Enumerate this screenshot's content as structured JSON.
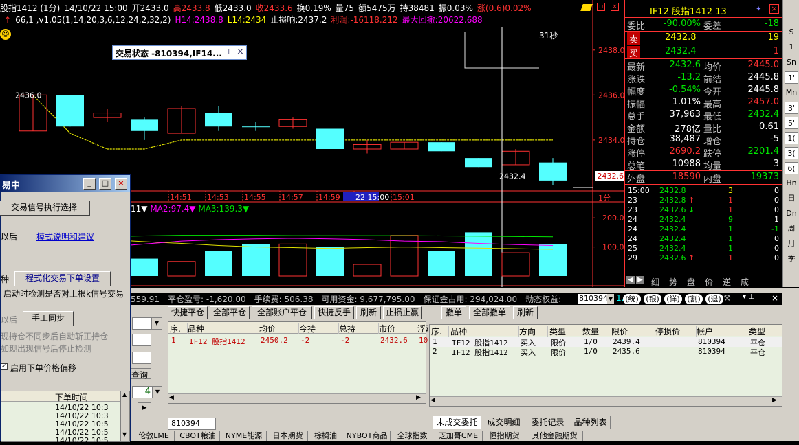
{
  "quote_bar": {
    "symbol": "股指1412 (1分)",
    "datetime": "14/10/22 15:00",
    "open": "开2433.0",
    "high": "高2433.8",
    "low": "低2433.0",
    "close": "收2433.6",
    "turnover_rate": "换0.19%",
    "volume": "量75",
    "amount": "额5475万",
    "position": "持38481",
    "amplitude": "振0.03%",
    "change": "涨(0.6)0.02%"
  },
  "indicator_bar": {
    "params": "66,1 ,v1.05(1,14,20,3,6,12,24,2,32,2)",
    "h14": "H14:2438.8",
    "l14": "L14:2434",
    "stop_loss": "止损响:2437.2",
    "profit": "利润:-16118.212",
    "max_drawdown": "最大回撤:20622.688"
  },
  "chart_data": {
    "type": "candlestick",
    "x_ticks": [
      "14:51",
      "14:53",
      "14:55",
      "14:57",
      "14:59",
      "22 15:00",
      "15:01"
    ],
    "y_ticks": [
      "2438.0",
      "2436.0",
      "2434.0"
    ],
    "current_price_label": "2432.6",
    "countdown": "31秒",
    "candles": [
      {
        "open": 2436.0,
        "close": 2434.4,
        "high": 2436.0,
        "low": 2434.4,
        "up": true
      },
      {
        "open": 2434.6,
        "close": 2436.0,
        "high": 2436.0,
        "low": 2434.6,
        "up": false
      },
      {
        "open": 2435.2,
        "close": 2435.0,
        "high": 2435.4,
        "low": 2434.8,
        "up": true
      },
      {
        "open": 2434.9,
        "close": 2434.4,
        "high": 2435.0,
        "low": 2434.0,
        "up": false
      },
      {
        "open": 2434.3,
        "close": 2435.4,
        "high": 2435.5,
        "low": 2434.3,
        "up": true
      },
      {
        "open": 2435.2,
        "close": 2434.6,
        "high": 2435.5,
        "low": 2434.4,
        "up": false
      },
      {
        "open": 2434.6,
        "close": 2434.6,
        "high": 2434.8,
        "low": 2434.4,
        "up": false
      },
      {
        "open": 2434.6,
        "close": 2434.9,
        "high": 2435.0,
        "low": 2434.5,
        "up": true
      },
      {
        "open": 2434.5,
        "close": 2433.6,
        "high": 2434.5,
        "low": 2433.6,
        "up": false
      },
      {
        "open": 2433.8,
        "close": 2433.6,
        "high": 2434.0,
        "low": 2433.4,
        "up": true
      },
      {
        "open": 2433.6,
        "close": 2433.9,
        "high": 2433.9,
        "low": 2433.6,
        "up": true
      },
      {
        "open": 2433.9,
        "close": 2433.5,
        "high": 2433.9,
        "low": 2433.5,
        "up": false
      },
      {
        "open": 2433.2,
        "close": 2432.8,
        "high": 2433.2,
        "low": 2432.8,
        "up": false
      },
      {
        "open": 2432.9,
        "close": 2433.5,
        "high": 2433.6,
        "low": 2432.9,
        "up": true
      },
      {
        "open": 2433.0,
        "close": 2432.2,
        "high": 2433.2,
        "low": 2432.0,
        "up": false
      }
    ],
    "annotations": [
      "2436.0",
      "2432.4"
    ],
    "ymin": 2431.8,
    "ymax": 2439.0,
    "volume_ticks": [
      "200.0",
      "100.0"
    ],
    "volume_legend": [
      "11▼",
      "MA2:97.4▼",
      "MA3:139.3▼"
    ],
    "volumes": [
      120,
      115,
      40,
      60,
      50,
      85,
      110,
      110,
      100,
      40,
      140,
      85,
      150,
      80,
      110
    ],
    "volume_max": 250,
    "ma_trace": [
      150,
      140,
      125,
      118,
      112,
      105,
      100,
      98,
      95,
      98,
      100,
      98,
      96,
      94,
      92
    ],
    "ma2_trace": [
      70,
      80,
      100,
      110,
      120,
      125,
      128,
      130,
      128,
      125,
      120,
      118,
      112,
      108,
      105
    ],
    "ma3_trace": [
      130,
      132,
      135,
      138,
      140,
      140,
      140,
      139,
      139,
      139,
      139,
      138,
      137,
      136,
      135
    ],
    "stop_line": [
      2436.0,
      2434.3,
      2433.6,
      2433.6,
      2434.0,
      2434.0,
      2434.0,
      2434.0,
      2434.0,
      2434.0,
      2434.0,
      2434.0,
      2434.0,
      2434.0,
      2434.0
    ],
    "hi_line": [
      2438.8,
      2438.8,
      2438.8,
      2438.8,
      2438.8,
      2438.8,
      2438.8,
      2438.8,
      2438.8,
      2438.8,
      2438.8,
      2438.8,
      2437.2,
      2437.2,
      2437.2
    ]
  },
  "right_panel": {
    "title": "IF12  股指1412  13",
    "weibi_label": "委比",
    "weibi": "-90.00%",
    "weicha_label": "委差",
    "weicha": "-18",
    "sell_label": "卖",
    "sell_price": "2432.8",
    "sell_qty": "19",
    "buy_label": "买",
    "buy_price": "2432.4",
    "buy_qty": "1",
    "rows": [
      {
        "k1": "最新",
        "v1": "2432.6",
        "c1": "g",
        "k2": "均价",
        "v2": "2445.0",
        "c2": "r"
      },
      {
        "k1": "涨跌",
        "v1": "-13.2",
        "c1": "g",
        "k2": "前结",
        "v2": "2445.8",
        "c2": "w"
      },
      {
        "k1": "幅度",
        "v1": "-0.54%",
        "c1": "g",
        "k2": "今开",
        "v2": "2445.8",
        "c2": "w"
      },
      {
        "k1": "振幅",
        "v1": "1.01%",
        "c1": "w",
        "k2": "最高",
        "v2": "2457.0",
        "c2": "r"
      },
      {
        "k1": "总手",
        "v1": "37,963",
        "c1": "w",
        "k2": "最低",
        "v2": "2432.4",
        "c2": "g"
      },
      {
        "k1": "金额",
        "v1": "278亿",
        "c1": "w",
        "k2": "量比",
        "v2": "0.61",
        "c2": "w"
      },
      {
        "k1": "持仓",
        "v1": "38,487",
        "c1": "w",
        "k2": "增仓",
        "v2": "-5",
        "c2": "w"
      },
      {
        "k1": "涨停",
        "v1": "2690.2",
        "c1": "r",
        "k2": "跌停",
        "v2": "2201.4",
        "c2": "g"
      },
      {
        "k1": "总笔",
        "v1": "10988",
        "c1": "w",
        "k2": "均量",
        "v2": "3",
        "c2": "w"
      }
    ],
    "outer_label": "外盘",
    "outer": "18590",
    "inner_label": "内盘",
    "inner": "19373",
    "ticks": [
      {
        "t": "15:00",
        "p": "2432.8",
        "a": "",
        "v": "3",
        "d": "0",
        "pc": "g",
        "ac": "w",
        "vc": "y",
        "dc": "w"
      },
      {
        "t": "23",
        "p": "2432.8",
        "a": "↑",
        "v": "1",
        "d": "0",
        "pc": "g",
        "ac": "r",
        "vc": "r",
        "dc": "w"
      },
      {
        "t": "23",
        "p": "2432.6",
        "a": "↓",
        "v": "1",
        "d": "0",
        "pc": "g",
        "ac": "g",
        "vc": "r",
        "dc": "w"
      },
      {
        "t": "24",
        "p": "2432.4",
        "a": "",
        "v": "9",
        "d": "1",
        "pc": "g",
        "ac": "w",
        "vc": "g",
        "dc": "w"
      },
      {
        "t": "24",
        "p": "2432.4",
        "a": "",
        "v": "1",
        "d": "-1",
        "pc": "g",
        "ac": "w",
        "vc": "g",
        "dc": "g"
      },
      {
        "t": "24",
        "p": "2432.4",
        "a": "",
        "v": "1",
        "d": "0",
        "pc": "g",
        "ac": "w",
        "vc": "g",
        "dc": "w"
      },
      {
        "t": "25",
        "p": "2432.4",
        "a": "",
        "v": "1",
        "d": "0",
        "pc": "g",
        "ac": "w",
        "vc": "g",
        "dc": "w"
      },
      {
        "t": "29",
        "p": "2432.6",
        "a": "↑",
        "v": "1",
        "d": "0",
        "pc": "g",
        "ac": "r",
        "vc": "r",
        "dc": "w"
      }
    ],
    "tabs": [
      "细",
      "势",
      "盘",
      "价",
      "逆",
      "成"
    ]
  },
  "far_right": [
    "S",
    "1",
    "Sn",
    "1'",
    "Mn",
    "3'",
    "5'",
    "1(",
    "3(",
    "6(",
    "Hn",
    "日",
    "Dn",
    "周",
    "月",
    "季"
  ],
  "float_window": {
    "title": "交易状态 -810394,IF14..."
  },
  "dialog": {
    "title": "易中",
    "exec_btn": "交易信号执行选择",
    "after_label": "以后",
    "mode_link": "模式说明和建议",
    "kind_label": "种",
    "settings_btn": "程式化交易下单设置",
    "check_note": "启动时检测是否对上根k信号交易",
    "after2_label": "以后",
    "manual_btn": "手工同步",
    "note1": "现持仓不同步后自动斩正持仓",
    "note2": "如现出现信号后停止检测",
    "price_offset": "启用下单价格偏移",
    "time_header": "下单时间",
    "times": [
      "14/10/22 10:3",
      "14/10/22 10:3",
      "14/10/22 10:5",
      "14/10/22 10:5",
      "14/10/22 10:5"
    ]
  },
  "account_bar": {
    "balance": "559.91",
    "close_pl": "平仓盈亏: -1,620.00",
    "fee": "手续费: 506.38",
    "available": "可用资金: 9,677,795.00",
    "margin": "保证金占用: 294,024.00",
    "dynamic": "动态权益:",
    "account": "810394",
    "btns": [
      "统",
      "银",
      "详",
      "割",
      "退"
    ]
  },
  "positions": {
    "buttons": [
      "快捷平仓",
      "全部平仓",
      "全部账户平仓",
      "快捷反手",
      "刷新",
      "止损止赢"
    ],
    "headers": [
      "序.",
      "品种",
      "均价",
      "今持",
      "总持",
      "市价",
      "浮动2"
    ],
    "rows": [
      [
        "1",
        "IF12 股指1412",
        "2450.2",
        "-2",
        "-2",
        "2432.6",
        "10559"
      ]
    ],
    "account": "810394"
  },
  "orders": {
    "buttons": [
      "撤单",
      "全部撤单",
      "刷新"
    ],
    "headers": [
      "序.",
      "品种",
      "方向",
      "类型",
      "数量",
      "限价",
      "停损价",
      "帐户",
      "类型"
    ],
    "rows": [
      [
        "1",
        "IF12 股指1412",
        "买入",
        "限价",
        "1/0",
        "2439.4",
        "",
        "810394",
        "平仓"
      ],
      [
        "2",
        "IF12 股指1412",
        "买入",
        "限价",
        "1/0",
        "2435.6",
        "",
        "810394",
        "平仓"
      ]
    ],
    "tabs": [
      "未成交委托",
      "成交明细",
      "委托记录",
      "品种列表"
    ]
  },
  "market_tabs": [
    "伦敦LME",
    "CBOT粮油",
    "NYME能源",
    "日本期货",
    "棕榈油",
    "NYBOT商品",
    "全球指数",
    "芝加哥CME",
    "恒指期货",
    "其他金融期货"
  ],
  "left_misc": {
    "query_tab": "查询",
    "num": "4"
  },
  "volume_unit": "1分"
}
